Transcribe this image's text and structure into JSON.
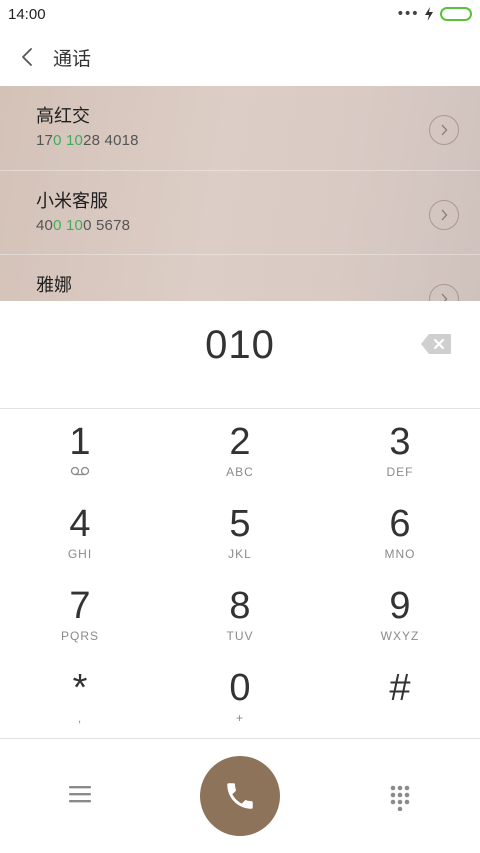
{
  "status_bar": {
    "time": "14:00",
    "battery_color": "#5ac13b"
  },
  "header": {
    "title": "通话",
    "back_icon": "chevron-left-icon"
  },
  "contacts": [
    {
      "name": "高红交",
      "number_parts": [
        "17",
        "0 10",
        "28 4018"
      ]
    },
    {
      "name": "小米客服",
      "number_parts": [
        "40",
        "0 10",
        "0 5678"
      ]
    },
    {
      "name": "雅娜",
      "number_parts": [
        "",
        "",
        ""
      ]
    }
  ],
  "dial": {
    "number": "010"
  },
  "keypad": [
    {
      "digit": "1",
      "sub": "",
      "sub_icon": "voicemail-icon"
    },
    {
      "digit": "2",
      "sub": "ABC"
    },
    {
      "digit": "3",
      "sub": "DEF"
    },
    {
      "digit": "4",
      "sub": "GHI"
    },
    {
      "digit": "5",
      "sub": "JKL"
    },
    {
      "digit": "6",
      "sub": "MNO"
    },
    {
      "digit": "7",
      "sub": "PQRS"
    },
    {
      "digit": "8",
      "sub": "TUV"
    },
    {
      "digit": "9",
      "sub": "WXYZ"
    },
    {
      "digit": "*",
      "sub": ","
    },
    {
      "digit": "0",
      "sub": "+"
    },
    {
      "digit": "#",
      "sub": ""
    }
  ],
  "colors": {
    "accent_green": "#3fae5a",
    "call_button": "#8c7359",
    "contact_bg": "#d9cbc4"
  },
  "bottom_bar": {
    "left_icon": "menu-icon",
    "call_icon": "phone-icon",
    "right_icon": "dialpad-icon"
  }
}
